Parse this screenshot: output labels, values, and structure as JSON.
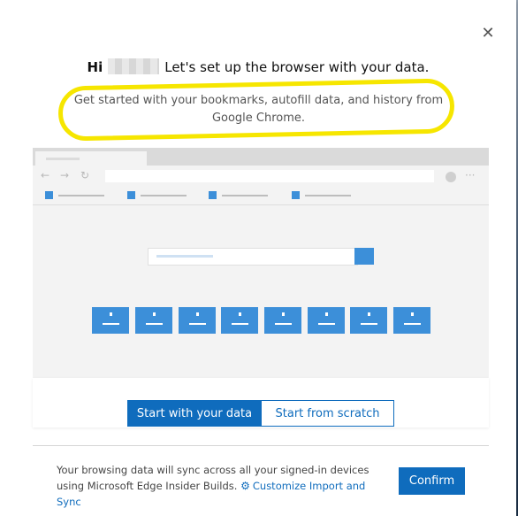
{
  "dialog": {
    "close_icon": "close-icon",
    "greeting": "Hi",
    "title_rest": "Let's set up the browser with your data.",
    "subtitle": "Get started with your bookmarks, autofill data, and history from Google Chrome.",
    "highlight_color": "#f6e600"
  },
  "actions": {
    "start_with_data": "Start with your data",
    "start_from_scratch": "Start from scratch"
  },
  "footer": {
    "message": "Your browsing data will sync across all your signed-in devices using Microsoft Edge Insider Builds.",
    "customize_icon": "gear-icon",
    "customize_link": "Customize Import and Sync",
    "confirm_label": "Confirm"
  },
  "colors": {
    "accent": "#0f6cbd",
    "illustration_blue": "#3c8fd9"
  }
}
